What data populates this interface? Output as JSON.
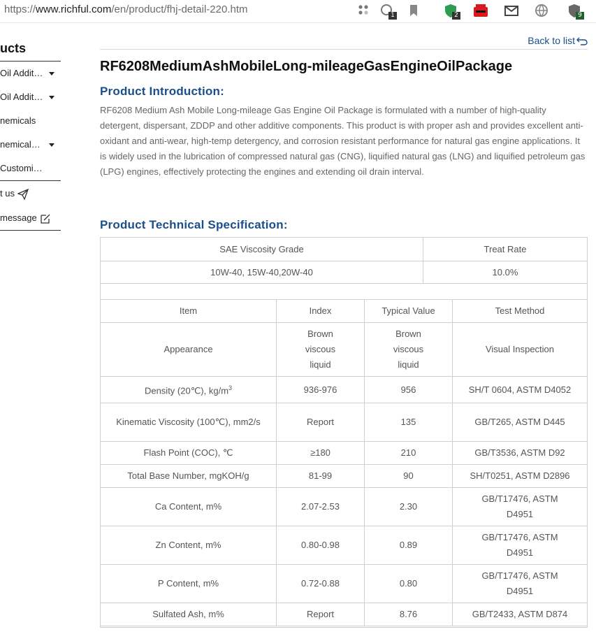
{
  "browser": {
    "url_prefix": "https://",
    "url_host": "www.richful.com",
    "url_path": "/en/product/fhj-detail-220.htm",
    "ext_badges": [
      "1",
      "2",
      "9"
    ]
  },
  "sidebar": {
    "title": "ucts",
    "items": [
      {
        "label": "Oil Additi…"
      },
      {
        "label": "Oil Additi…"
      },
      {
        "label": "nemicals"
      },
      {
        "label": "nemicals …"
      },
      {
        "label": "Customi…"
      }
    ],
    "contact_label": "t us",
    "message_label": "message"
  },
  "main": {
    "back_label": "Back to list",
    "title": "RF6208MediumAshMobileLong-mileageGasEngineOilPackage",
    "intro_heading": "Product Introduction:",
    "intro_text": "RF6208 Medium Ash Mobile Long-mileage Gas Engine Oil Package is formulated with a number of high-quality detergent, dispersant, ZDDP and other additive components. This product is with proper ash and provides excellent anti-oxidant and anti-wear, high-temp detergency, and corrosion resistant performance for natural gas engine applications. It is widely used in the lubrication of compressed natural gas (CNG), liquified natural gas (LNG) and liquified petroleum gas (LPG) engines, effectively protecting the engines and extending oil drain interval.",
    "spec_heading": "Product Technical Specification:"
  },
  "viscosity_table": {
    "headers": [
      "SAE Viscosity Grade",
      "Treat Rate"
    ],
    "row": [
      "10W-40, 15W-40,20W-40",
      "10.0%"
    ]
  },
  "spec_table": {
    "headers": [
      "Item",
      "Index",
      "Typical Value",
      "Test Method"
    ],
    "rows": [
      {
        "item": "Appearance",
        "index": "Brown viscous liquid",
        "typical": "Brown viscous liquid",
        "method": "Visual Inspection"
      },
      {
        "item": "Density (20℃), kg/m",
        "item_sup": "3",
        "index": "936-976",
        "typical": "956",
        "method": "SH/T 0604, ASTM D4052"
      },
      {
        "item": "Kinematic Viscosity (100℃), mm2/s",
        "index": "Report",
        "typical": "135",
        "method": "GB/T265, ASTM D445"
      },
      {
        "item": "Flash Point (COC), ℃",
        "index": "≥180",
        "typical": "210",
        "method": "GB/T3536, ASTM D92"
      },
      {
        "item": "Total Base Number, mgKOH/g",
        "index": "81-99",
        "typical": "90",
        "method": "SH/T0251, ASTM D2896"
      },
      {
        "item": "Ca Content, m%",
        "index": "2.07-2.53",
        "typical": "2.30",
        "method": "GB/T17476, ASTM D4951"
      },
      {
        "item": "Zn Content, m%",
        "index": "0.80-0.98",
        "typical": "0.89",
        "method": "GB/T17476, ASTM D4951"
      },
      {
        "item": "P Content, m%",
        "index": "0.72-0.88",
        "typical": "0.80",
        "method": "GB/T17476, ASTM D4951"
      },
      {
        "item": "Sulfated Ash, m%",
        "index": "Report",
        "typical": "8.76",
        "method": "GB/T2433, ASTM D874"
      }
    ]
  }
}
